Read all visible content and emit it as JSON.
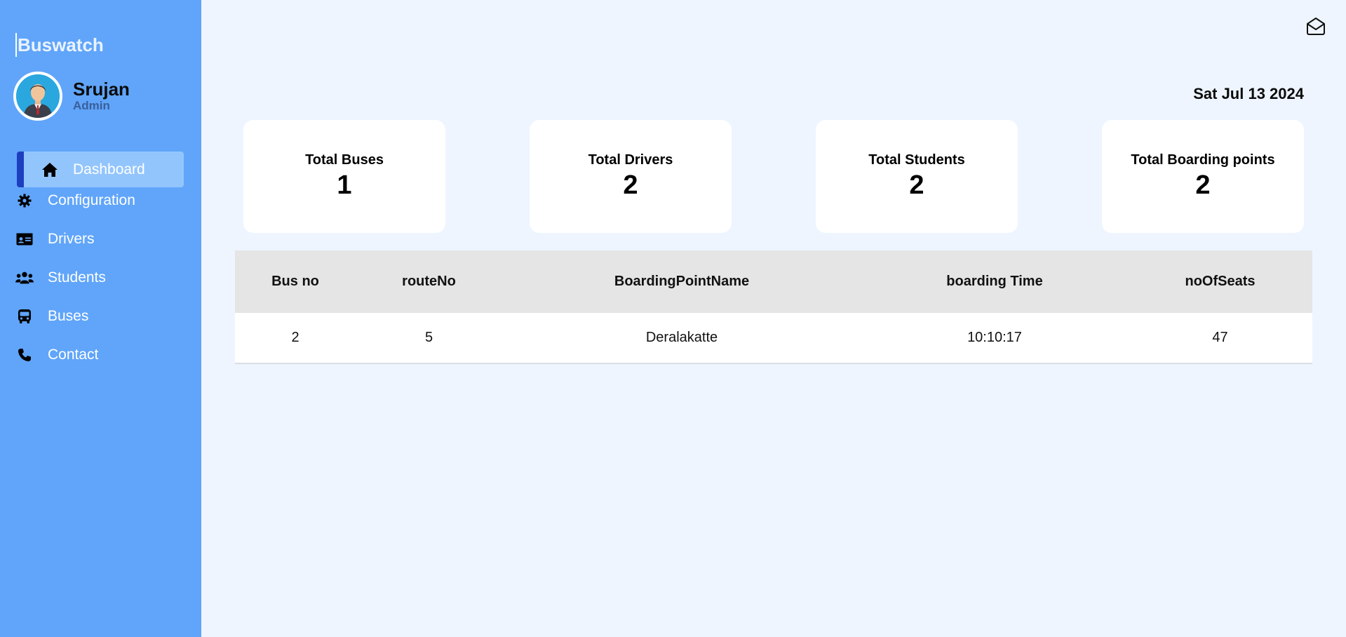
{
  "app": {
    "brand": "Buswatch"
  },
  "user": {
    "name": "Srujan",
    "role": "Admin"
  },
  "nav": [
    {
      "label": "Dashboard",
      "icon": "home-icon",
      "active": true
    },
    {
      "label": "Configuration",
      "icon": "gear-icon"
    },
    {
      "label": "Drivers",
      "icon": "id-card-icon"
    },
    {
      "label": "Students",
      "icon": "users-icon"
    },
    {
      "label": "Buses",
      "icon": "bus-icon"
    },
    {
      "label": "Contact",
      "icon": "phone-icon"
    }
  ],
  "header": {
    "date": "Sat Jul 13 2024",
    "mail_icon": "envelope-open-icon"
  },
  "stats": [
    {
      "title": "Total Buses",
      "value": "1"
    },
    {
      "title": "Total Drivers",
      "value": "2"
    },
    {
      "title": "Total Students",
      "value": "2"
    },
    {
      "title": "Total Boarding points",
      "value": "2"
    }
  ],
  "table": {
    "columns": [
      "Bus no",
      "routeNo",
      "BoardingPointName",
      "boarding Time",
      "noOfSeats"
    ],
    "rows": [
      [
        "2",
        "5",
        "Deralakatte",
        "10:10:17",
        "47"
      ]
    ]
  },
  "colors": {
    "sidebar": "#60a5fa",
    "active_item": "#93c5fd",
    "active_marker": "#1d3fbf",
    "page_bg": "#eef5ff"
  }
}
